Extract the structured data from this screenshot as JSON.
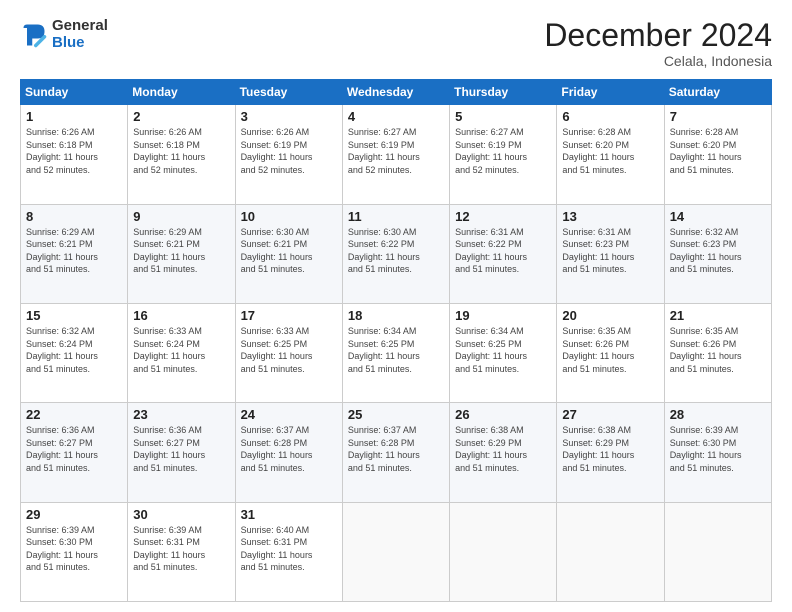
{
  "header": {
    "logo_line1": "General",
    "logo_line2": "Blue",
    "month": "December 2024",
    "location": "Celala, Indonesia"
  },
  "weekdays": [
    "Sunday",
    "Monday",
    "Tuesday",
    "Wednesday",
    "Thursday",
    "Friday",
    "Saturday"
  ],
  "weeks": [
    [
      {
        "day": "1",
        "info": "Sunrise: 6:26 AM\nSunset: 6:18 PM\nDaylight: 11 hours\nand 52 minutes."
      },
      {
        "day": "2",
        "info": "Sunrise: 6:26 AM\nSunset: 6:18 PM\nDaylight: 11 hours\nand 52 minutes."
      },
      {
        "day": "3",
        "info": "Sunrise: 6:26 AM\nSunset: 6:19 PM\nDaylight: 11 hours\nand 52 minutes."
      },
      {
        "day": "4",
        "info": "Sunrise: 6:27 AM\nSunset: 6:19 PM\nDaylight: 11 hours\nand 52 minutes."
      },
      {
        "day": "5",
        "info": "Sunrise: 6:27 AM\nSunset: 6:19 PM\nDaylight: 11 hours\nand 52 minutes."
      },
      {
        "day": "6",
        "info": "Sunrise: 6:28 AM\nSunset: 6:20 PM\nDaylight: 11 hours\nand 51 minutes."
      },
      {
        "day": "7",
        "info": "Sunrise: 6:28 AM\nSunset: 6:20 PM\nDaylight: 11 hours\nand 51 minutes."
      }
    ],
    [
      {
        "day": "8",
        "info": "Sunrise: 6:29 AM\nSunset: 6:21 PM\nDaylight: 11 hours\nand 51 minutes."
      },
      {
        "day": "9",
        "info": "Sunrise: 6:29 AM\nSunset: 6:21 PM\nDaylight: 11 hours\nand 51 minutes."
      },
      {
        "day": "10",
        "info": "Sunrise: 6:30 AM\nSunset: 6:21 PM\nDaylight: 11 hours\nand 51 minutes."
      },
      {
        "day": "11",
        "info": "Sunrise: 6:30 AM\nSunset: 6:22 PM\nDaylight: 11 hours\nand 51 minutes."
      },
      {
        "day": "12",
        "info": "Sunrise: 6:31 AM\nSunset: 6:22 PM\nDaylight: 11 hours\nand 51 minutes."
      },
      {
        "day": "13",
        "info": "Sunrise: 6:31 AM\nSunset: 6:23 PM\nDaylight: 11 hours\nand 51 minutes."
      },
      {
        "day": "14",
        "info": "Sunrise: 6:32 AM\nSunset: 6:23 PM\nDaylight: 11 hours\nand 51 minutes."
      }
    ],
    [
      {
        "day": "15",
        "info": "Sunrise: 6:32 AM\nSunset: 6:24 PM\nDaylight: 11 hours\nand 51 minutes."
      },
      {
        "day": "16",
        "info": "Sunrise: 6:33 AM\nSunset: 6:24 PM\nDaylight: 11 hours\nand 51 minutes."
      },
      {
        "day": "17",
        "info": "Sunrise: 6:33 AM\nSunset: 6:25 PM\nDaylight: 11 hours\nand 51 minutes."
      },
      {
        "day": "18",
        "info": "Sunrise: 6:34 AM\nSunset: 6:25 PM\nDaylight: 11 hours\nand 51 minutes."
      },
      {
        "day": "19",
        "info": "Sunrise: 6:34 AM\nSunset: 6:25 PM\nDaylight: 11 hours\nand 51 minutes."
      },
      {
        "day": "20",
        "info": "Sunrise: 6:35 AM\nSunset: 6:26 PM\nDaylight: 11 hours\nand 51 minutes."
      },
      {
        "day": "21",
        "info": "Sunrise: 6:35 AM\nSunset: 6:26 PM\nDaylight: 11 hours\nand 51 minutes."
      }
    ],
    [
      {
        "day": "22",
        "info": "Sunrise: 6:36 AM\nSunset: 6:27 PM\nDaylight: 11 hours\nand 51 minutes."
      },
      {
        "day": "23",
        "info": "Sunrise: 6:36 AM\nSunset: 6:27 PM\nDaylight: 11 hours\nand 51 minutes."
      },
      {
        "day": "24",
        "info": "Sunrise: 6:37 AM\nSunset: 6:28 PM\nDaylight: 11 hours\nand 51 minutes."
      },
      {
        "day": "25",
        "info": "Sunrise: 6:37 AM\nSunset: 6:28 PM\nDaylight: 11 hours\nand 51 minutes."
      },
      {
        "day": "26",
        "info": "Sunrise: 6:38 AM\nSunset: 6:29 PM\nDaylight: 11 hours\nand 51 minutes."
      },
      {
        "day": "27",
        "info": "Sunrise: 6:38 AM\nSunset: 6:29 PM\nDaylight: 11 hours\nand 51 minutes."
      },
      {
        "day": "28",
        "info": "Sunrise: 6:39 AM\nSunset: 6:30 PM\nDaylight: 11 hours\nand 51 minutes."
      }
    ],
    [
      {
        "day": "29",
        "info": "Sunrise: 6:39 AM\nSunset: 6:30 PM\nDaylight: 11 hours\nand 51 minutes."
      },
      {
        "day": "30",
        "info": "Sunrise: 6:39 AM\nSunset: 6:31 PM\nDaylight: 11 hours\nand 51 minutes."
      },
      {
        "day": "31",
        "info": "Sunrise: 6:40 AM\nSunset: 6:31 PM\nDaylight: 11 hours\nand 51 minutes."
      },
      {
        "day": "",
        "info": ""
      },
      {
        "day": "",
        "info": ""
      },
      {
        "day": "",
        "info": ""
      },
      {
        "day": "",
        "info": ""
      }
    ]
  ]
}
